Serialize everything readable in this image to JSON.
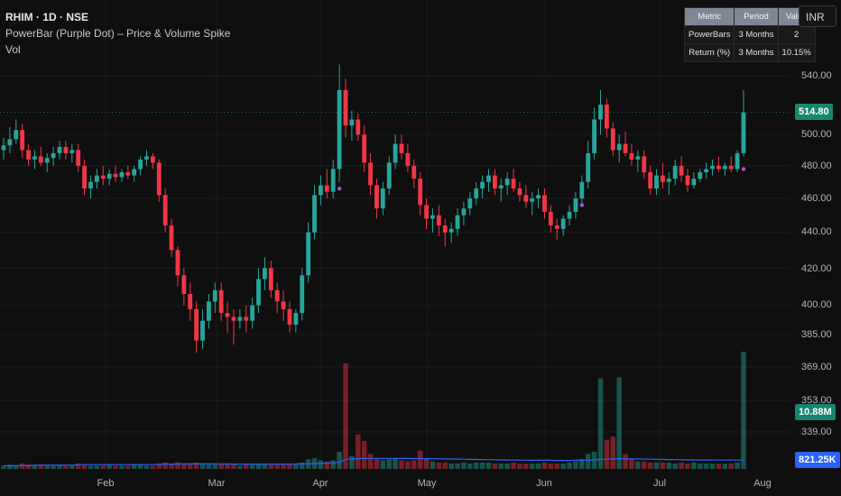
{
  "header": {
    "symbol_line": "RHIM · 1D · NSE",
    "indicator_line": "PowerBar (Purple Dot) – Price & Volume Spike",
    "volume_line": "Vol"
  },
  "currency_button": "INR",
  "stats_table": {
    "headers": [
      "Metric",
      "Period",
      "Value"
    ],
    "rows": [
      [
        "PowerBars",
        "3 Months",
        "2"
      ],
      [
        "Return (%)",
        "3 Months",
        "10.15%"
      ]
    ]
  },
  "price_axis": {
    "ticks": [
      "540.00",
      "500.00",
      "480.00",
      "460.00",
      "440.00",
      "420.00",
      "400.00",
      "385.00",
      "369.00",
      "353.00",
      "339.00"
    ],
    "last_price": "514.80",
    "volume_label": "10.88M",
    "avg_volume_label": "821.25K"
  },
  "time_axis": {
    "months": [
      "Feb",
      "Mar",
      "Apr",
      "May",
      "Jun",
      "Jul",
      "Aug"
    ]
  },
  "colors": {
    "up": "#26a69a",
    "down": "#f23645",
    "powerbar_dot": "#b04fd6",
    "avg_line": "#2962ff",
    "background": "#0f0f0f"
  },
  "chart_data": {
    "type": "candlestick",
    "scale": "log",
    "ylim": [
      330,
      560
    ],
    "candles": [
      {
        "o": 490,
        "h": 498,
        "l": 484,
        "c": 493
      },
      {
        "o": 493,
        "h": 505,
        "l": 488,
        "c": 497
      },
      {
        "o": 497,
        "h": 510,
        "l": 494,
        "c": 503
      },
      {
        "o": 503,
        "h": 507,
        "l": 485,
        "c": 490
      },
      {
        "o": 490,
        "h": 494,
        "l": 480,
        "c": 484
      },
      {
        "o": 484,
        "h": 490,
        "l": 478,
        "c": 486
      },
      {
        "o": 486,
        "h": 492,
        "l": 480,
        "c": 482
      },
      {
        "o": 482,
        "h": 488,
        "l": 476,
        "c": 485
      },
      {
        "o": 485,
        "h": 492,
        "l": 480,
        "c": 488
      },
      {
        "o": 488,
        "h": 496,
        "l": 484,
        "c": 492
      },
      {
        "o": 492,
        "h": 496,
        "l": 484,
        "c": 488
      },
      {
        "o": 488,
        "h": 494,
        "l": 482,
        "c": 490
      },
      {
        "o": 490,
        "h": 494,
        "l": 476,
        "c": 480
      },
      {
        "o": 480,
        "h": 484,
        "l": 462,
        "c": 466
      },
      {
        "o": 466,
        "h": 474,
        "l": 460,
        "c": 470
      },
      {
        "o": 470,
        "h": 478,
        "l": 466,
        "c": 474
      },
      {
        "o": 474,
        "h": 480,
        "l": 468,
        "c": 472
      },
      {
        "o": 472,
        "h": 478,
        "l": 468,
        "c": 475
      },
      {
        "o": 475,
        "h": 480,
        "l": 470,
        "c": 473
      },
      {
        "o": 473,
        "h": 478,
        "l": 470,
        "c": 476
      },
      {
        "o": 476,
        "h": 480,
        "l": 472,
        "c": 474
      },
      {
        "o": 474,
        "h": 480,
        "l": 470,
        "c": 478
      },
      {
        "o": 478,
        "h": 486,
        "l": 474,
        "c": 484
      },
      {
        "o": 484,
        "h": 490,
        "l": 480,
        "c": 486
      },
      {
        "o": 486,
        "h": 488,
        "l": 478,
        "c": 482
      },
      {
        "o": 482,
        "h": 484,
        "l": 458,
        "c": 462
      },
      {
        "o": 462,
        "h": 466,
        "l": 440,
        "c": 444
      },
      {
        "o": 444,
        "h": 448,
        "l": 426,
        "c": 430
      },
      {
        "o": 430,
        "h": 432,
        "l": 410,
        "c": 416
      },
      {
        "o": 416,
        "h": 420,
        "l": 400,
        "c": 406
      },
      {
        "o": 406,
        "h": 412,
        "l": 392,
        "c": 398
      },
      {
        "o": 398,
        "h": 402,
        "l": 376,
        "c": 382
      },
      {
        "o": 382,
        "h": 398,
        "l": 378,
        "c": 392
      },
      {
        "o": 392,
        "h": 406,
        "l": 388,
        "c": 402
      },
      {
        "o": 402,
        "h": 412,
        "l": 396,
        "c": 408
      },
      {
        "o": 408,
        "h": 412,
        "l": 392,
        "c": 396
      },
      {
        "o": 396,
        "h": 402,
        "l": 386,
        "c": 394
      },
      {
        "o": 394,
        "h": 398,
        "l": 380,
        "c": 392
      },
      {
        "o": 392,
        "h": 398,
        "l": 388,
        "c": 394
      },
      {
        "o": 394,
        "h": 400,
        "l": 386,
        "c": 392
      },
      {
        "o": 392,
        "h": 404,
        "l": 388,
        "c": 400
      },
      {
        "o": 400,
        "h": 420,
        "l": 396,
        "c": 414
      },
      {
        "o": 414,
        "h": 426,
        "l": 408,
        "c": 420
      },
      {
        "o": 420,
        "h": 424,
        "l": 404,
        "c": 408
      },
      {
        "o": 408,
        "h": 412,
        "l": 396,
        "c": 402
      },
      {
        "o": 402,
        "h": 408,
        "l": 392,
        "c": 398
      },
      {
        "o": 398,
        "h": 402,
        "l": 386,
        "c": 390
      },
      {
        "o": 390,
        "h": 398,
        "l": 386,
        "c": 396
      },
      {
        "o": 396,
        "h": 420,
        "l": 392,
        "c": 416
      },
      {
        "o": 416,
        "h": 446,
        "l": 412,
        "c": 440
      },
      {
        "o": 440,
        "h": 468,
        "l": 436,
        "c": 462
      },
      {
        "o": 462,
        "h": 474,
        "l": 456,
        "c": 468
      },
      {
        "o": 468,
        "h": 478,
        "l": 460,
        "c": 464
      },
      {
        "o": 464,
        "h": 484,
        "l": 460,
        "c": 478
      },
      {
        "o": 478,
        "h": 548,
        "l": 470,
        "c": 530
      },
      {
        "o": 530,
        "h": 538,
        "l": 498,
        "c": 506
      },
      {
        "o": 506,
        "h": 516,
        "l": 496,
        "c": 510
      },
      {
        "o": 510,
        "h": 514,
        "l": 496,
        "c": 500
      },
      {
        "o": 500,
        "h": 506,
        "l": 476,
        "c": 482
      },
      {
        "o": 482,
        "h": 488,
        "l": 462,
        "c": 468
      },
      {
        "o": 468,
        "h": 472,
        "l": 448,
        "c": 454
      },
      {
        "o": 454,
        "h": 470,
        "l": 450,
        "c": 466
      },
      {
        "o": 466,
        "h": 486,
        "l": 462,
        "c": 482
      },
      {
        "o": 482,
        "h": 500,
        "l": 478,
        "c": 494
      },
      {
        "o": 494,
        "h": 500,
        "l": 484,
        "c": 488
      },
      {
        "o": 488,
        "h": 494,
        "l": 476,
        "c": 480
      },
      {
        "o": 480,
        "h": 484,
        "l": 466,
        "c": 472
      },
      {
        "o": 472,
        "h": 476,
        "l": 450,
        "c": 456
      },
      {
        "o": 456,
        "h": 460,
        "l": 442,
        "c": 448
      },
      {
        "o": 448,
        "h": 454,
        "l": 440,
        "c": 450
      },
      {
        "o": 450,
        "h": 456,
        "l": 438,
        "c": 444
      },
      {
        "o": 444,
        "h": 448,
        "l": 432,
        "c": 440
      },
      {
        "o": 440,
        "h": 446,
        "l": 434,
        "c": 442
      },
      {
        "o": 442,
        "h": 454,
        "l": 438,
        "c": 450
      },
      {
        "o": 450,
        "h": 458,
        "l": 444,
        "c": 454
      },
      {
        "o": 454,
        "h": 464,
        "l": 450,
        "c": 460
      },
      {
        "o": 460,
        "h": 470,
        "l": 456,
        "c": 466
      },
      {
        "o": 466,
        "h": 474,
        "l": 460,
        "c": 470
      },
      {
        "o": 470,
        "h": 478,
        "l": 464,
        "c": 474
      },
      {
        "o": 474,
        "h": 478,
        "l": 462,
        "c": 466
      },
      {
        "o": 466,
        "h": 472,
        "l": 458,
        "c": 468
      },
      {
        "o": 468,
        "h": 476,
        "l": 462,
        "c": 472
      },
      {
        "o": 472,
        "h": 478,
        "l": 464,
        "c": 466
      },
      {
        "o": 466,
        "h": 470,
        "l": 458,
        "c": 462
      },
      {
        "o": 462,
        "h": 468,
        "l": 454,
        "c": 458
      },
      {
        "o": 458,
        "h": 464,
        "l": 450,
        "c": 460
      },
      {
        "o": 460,
        "h": 466,
        "l": 454,
        "c": 462
      },
      {
        "o": 462,
        "h": 466,
        "l": 448,
        "c": 452
      },
      {
        "o": 452,
        "h": 456,
        "l": 440,
        "c": 444
      },
      {
        "o": 444,
        "h": 448,
        "l": 436,
        "c": 442
      },
      {
        "o": 442,
        "h": 450,
        "l": 438,
        "c": 448
      },
      {
        "o": 448,
        "h": 456,
        "l": 444,
        "c": 452
      },
      {
        "o": 452,
        "h": 464,
        "l": 448,
        "c": 460
      },
      {
        "o": 460,
        "h": 474,
        "l": 456,
        "c": 470
      },
      {
        "o": 470,
        "h": 496,
        "l": 466,
        "c": 488
      },
      {
        "o": 488,
        "h": 518,
        "l": 484,
        "c": 510
      },
      {
        "o": 510,
        "h": 530,
        "l": 500,
        "c": 520
      },
      {
        "o": 520,
        "h": 524,
        "l": 498,
        "c": 504
      },
      {
        "o": 504,
        "h": 508,
        "l": 486,
        "c": 490
      },
      {
        "o": 490,
        "h": 500,
        "l": 482,
        "c": 494
      },
      {
        "o": 494,
        "h": 502,
        "l": 486,
        "c": 488
      },
      {
        "o": 488,
        "h": 494,
        "l": 480,
        "c": 484
      },
      {
        "o": 484,
        "h": 490,
        "l": 476,
        "c": 486
      },
      {
        "o": 486,
        "h": 490,
        "l": 472,
        "c": 476
      },
      {
        "o": 476,
        "h": 480,
        "l": 462,
        "c": 466
      },
      {
        "o": 466,
        "h": 478,
        "l": 462,
        "c": 474
      },
      {
        "o": 474,
        "h": 482,
        "l": 466,
        "c": 470
      },
      {
        "o": 470,
        "h": 476,
        "l": 462,
        "c": 472
      },
      {
        "o": 472,
        "h": 484,
        "l": 468,
        "c": 480
      },
      {
        "o": 480,
        "h": 486,
        "l": 470,
        "c": 474
      },
      {
        "o": 474,
        "h": 478,
        "l": 464,
        "c": 468
      },
      {
        "o": 468,
        "h": 476,
        "l": 466,
        "c": 472
      },
      {
        "o": 472,
        "h": 478,
        "l": 470,
        "c": 476
      },
      {
        "o": 476,
        "h": 482,
        "l": 472,
        "c": 478
      },
      {
        "o": 478,
        "h": 484,
        "l": 474,
        "c": 480
      },
      {
        "o": 480,
        "h": 486,
        "l": 476,
        "c": 478
      },
      {
        "o": 478,
        "h": 482,
        "l": 474,
        "c": 480
      },
      {
        "o": 480,
        "h": 486,
        "l": 476,
        "c": 478
      },
      {
        "o": 478,
        "h": 490,
        "l": 476,
        "c": 488
      },
      {
        "o": 488,
        "h": 530,
        "l": 486,
        "c": 514.8
      }
    ],
    "powerbar_dots": [
      {
        "i": 54,
        "price": 466
      },
      {
        "i": 93,
        "price": 456
      },
      {
        "i": 119,
        "price": 478
      }
    ],
    "volume": {
      "max": 10.88,
      "values": [
        0.3,
        0.4,
        0.3,
        0.5,
        0.4,
        0.3,
        0.4,
        0.3,
        0.3,
        0.4,
        0.3,
        0.3,
        0.5,
        0.4,
        0.3,
        0.3,
        0.3,
        0.4,
        0.3,
        0.3,
        0.3,
        0.4,
        0.4,
        0.3,
        0.3,
        0.5,
        0.6,
        0.5,
        0.6,
        0.5,
        0.5,
        0.6,
        0.5,
        0.4,
        0.4,
        0.5,
        0.4,
        0.4,
        0.3,
        0.4,
        0.4,
        0.5,
        0.5,
        0.4,
        0.4,
        0.4,
        0.5,
        0.5,
        0.6,
        0.9,
        1.0,
        0.8,
        0.7,
        0.8,
        1.6,
        9.8,
        1.2,
        3.2,
        2.6,
        1.4,
        0.9,
        0.8,
        0.9,
        1.0,
        0.8,
        0.7,
        0.8,
        1.7,
        0.9,
        0.7,
        0.6,
        0.6,
        0.5,
        0.5,
        0.6,
        0.5,
        0.6,
        0.6,
        0.6,
        0.5,
        0.5,
        0.5,
        0.6,
        0.5,
        0.5,
        0.5,
        0.5,
        0.6,
        0.5,
        0.5,
        0.5,
        0.6,
        0.7,
        0.9,
        1.4,
        1.6,
        8.4,
        2.7,
        3.0,
        8.5,
        1.4,
        0.9,
        0.7,
        0.7,
        0.6,
        0.6,
        0.6,
        0.6,
        0.5,
        0.6,
        0.5,
        0.6,
        0.5,
        0.5,
        0.5,
        0.5,
        0.5,
        0.5,
        0.6,
        10.88
      ],
      "avg": [
        0.3,
        0.3,
        0.3,
        0.3,
        0.3,
        0.35,
        0.35,
        0.35,
        0.35,
        0.35,
        0.35,
        0.35,
        0.4,
        0.4,
        0.4,
        0.4,
        0.4,
        0.4,
        0.4,
        0.4,
        0.4,
        0.4,
        0.4,
        0.4,
        0.4,
        0.42,
        0.44,
        0.45,
        0.46,
        0.46,
        0.47,
        0.47,
        0.47,
        0.47,
        0.46,
        0.46,
        0.46,
        0.45,
        0.45,
        0.45,
        0.45,
        0.45,
        0.45,
        0.45,
        0.45,
        0.45,
        0.45,
        0.46,
        0.47,
        0.48,
        0.5,
        0.52,
        0.54,
        0.56,
        0.6,
        0.9,
        0.92,
        0.95,
        0.97,
        0.98,
        0.98,
        0.98,
        0.98,
        0.98,
        0.97,
        0.97,
        0.96,
        0.96,
        0.95,
        0.95,
        0.94,
        0.93,
        0.92,
        0.91,
        0.9,
        0.89,
        0.88,
        0.87,
        0.86,
        0.85,
        0.84,
        0.83,
        0.82,
        0.82,
        0.81,
        0.8,
        0.8,
        0.8,
        0.8,
        0.79,
        0.79,
        0.79,
        0.8,
        0.8,
        0.82,
        0.84,
        0.88,
        0.9,
        0.92,
        0.95,
        0.94,
        0.93,
        0.92,
        0.91,
        0.9,
        0.89,
        0.88,
        0.87,
        0.86,
        0.85,
        0.84,
        0.84,
        0.83,
        0.83,
        0.82,
        0.82,
        0.82,
        0.82,
        0.82,
        0.82
      ]
    }
  }
}
